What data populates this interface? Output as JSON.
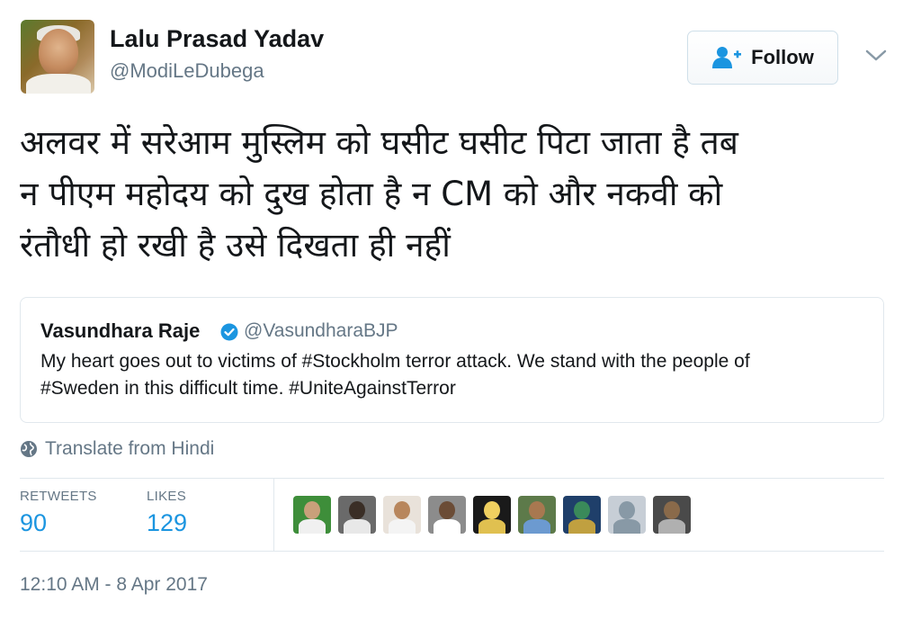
{
  "author": {
    "name": "Lalu Prasad Yadav",
    "handle": "@ModiLeDubega"
  },
  "follow_button": {
    "label": "Follow"
  },
  "tweet": {
    "lines": [
      "अलवर में सरेआम मुस्लिम को घसीट घसीट पिटा जाता है तब",
      "न पीएम महोदय को दुख होता है न CM को और नकवी को",
      "रंतौधी हो रखी है उसे दिखता ही नहीं"
    ]
  },
  "quoted_tweet": {
    "name": "Vasundhara Raje",
    "handle": "@VasundharaBJP",
    "lines": [
      "My heart goes out to victims of #Stockholm terror attack. We stand with  the people of",
      "#Sweden in this difficult time. #UniteAgainstTerror"
    ]
  },
  "translate": {
    "label": "Translate from Hindi"
  },
  "stats": {
    "retweets_label": "RETWEETS",
    "retweets_value": "90",
    "likes_label": "LIKES",
    "likes_value": "129"
  },
  "likers": [
    {
      "bg": "#3e8e3a",
      "head": "#c9a07a",
      "body": "#f0f0f0"
    },
    {
      "bg": "#6a6a6a",
      "head": "#3a2e26",
      "body": "#e8e8e8"
    },
    {
      "bg": "#e9e2da",
      "head": "#b8865c",
      "body": "#f4f4f4"
    },
    {
      "bg": "#8c8c8c",
      "head": "#6b4c36",
      "body": "#ffffff"
    },
    {
      "bg": "#1a1a1a",
      "head": "#f0d060",
      "body": "#e0c050"
    },
    {
      "bg": "#5d7a4a",
      "head": "#a87850",
      "body": "#6c9ad0"
    },
    {
      "bg": "#1f3f6a",
      "head": "#3a8a5a",
      "body": "#c0a040"
    },
    {
      "bg": "#c7ced6",
      "head": "#8899a6",
      "body": "#8899a6"
    },
    {
      "bg": "#4a4a4a",
      "head": "#8a6a4a",
      "body": "#b0b0b0"
    }
  ],
  "timestamp": "12:10 AM - 8 Apr 2017",
  "colors": {
    "accent": "#1b95e0",
    "secondary_text": "#657786",
    "border": "#e1e8ed"
  }
}
